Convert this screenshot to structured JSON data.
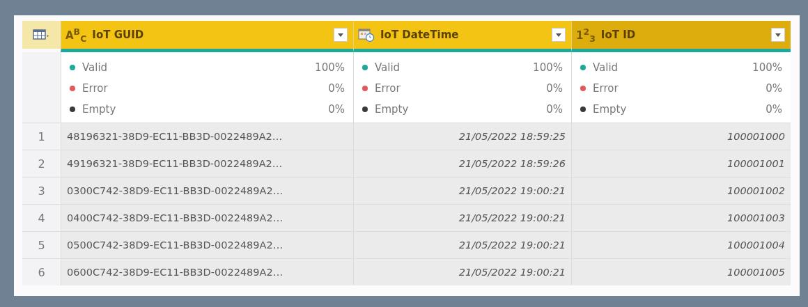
{
  "columns": [
    {
      "kind": "text",
      "type_label": "A$^{B}$$_{C}$",
      "name": "IoT GUID",
      "selected": false,
      "quality": [
        {
          "label": "Valid",
          "value": "100%",
          "color": "#1fa89a"
        },
        {
          "label": "Error",
          "value": "0%",
          "color": "#e05a5a"
        },
        {
          "label": "Empty",
          "value": "0%",
          "color": "#3a3a3a"
        }
      ]
    },
    {
      "kind": "datetime",
      "name": "IoT DateTime",
      "selected": false,
      "quality": [
        {
          "label": "Valid",
          "value": "100%",
          "color": "#1fa89a"
        },
        {
          "label": "Error",
          "value": "0%",
          "color": "#e05a5a"
        },
        {
          "label": "Empty",
          "value": "0%",
          "color": "#3a3a3a"
        }
      ]
    },
    {
      "kind": "number",
      "type_label": "1$^{2}$$_{3}$",
      "name": "IoT ID",
      "selected": true,
      "quality": [
        {
          "label": "Valid",
          "value": "100%",
          "color": "#1fa89a"
        },
        {
          "label": "Error",
          "value": "0%",
          "color": "#e05a5a"
        },
        {
          "label": "Empty",
          "value": "0%",
          "color": "#3a3a3a"
        }
      ]
    }
  ],
  "rows": [
    {
      "number": "1",
      "cells": [
        "48196321-38D9-EC11-BB3D-0022489A2…",
        "21/05/2022 18:59:25",
        "100001000"
      ]
    },
    {
      "number": "2",
      "cells": [
        "49196321-38D9-EC11-BB3D-0022489A2…",
        "21/05/2022 18:59:26",
        "100001001"
      ]
    },
    {
      "number": "3",
      "cells": [
        "0300C742-38D9-EC11-BB3D-0022489A2…",
        "21/05/2022 19:00:21",
        "100001002"
      ]
    },
    {
      "number": "4",
      "cells": [
        "0400C742-38D9-EC11-BB3D-0022489A2…",
        "21/05/2022 19:00:21",
        "100001003"
      ]
    },
    {
      "number": "5",
      "cells": [
        "0500C742-38D9-EC11-BB3D-0022489A2…",
        "21/05/2022 19:00:21",
        "100001004"
      ]
    },
    {
      "number": "6",
      "cells": [
        "0600C742-38D9-EC11-BB3D-0022489A2…",
        "21/05/2022 19:00:21",
        "100001005"
      ]
    }
  ]
}
